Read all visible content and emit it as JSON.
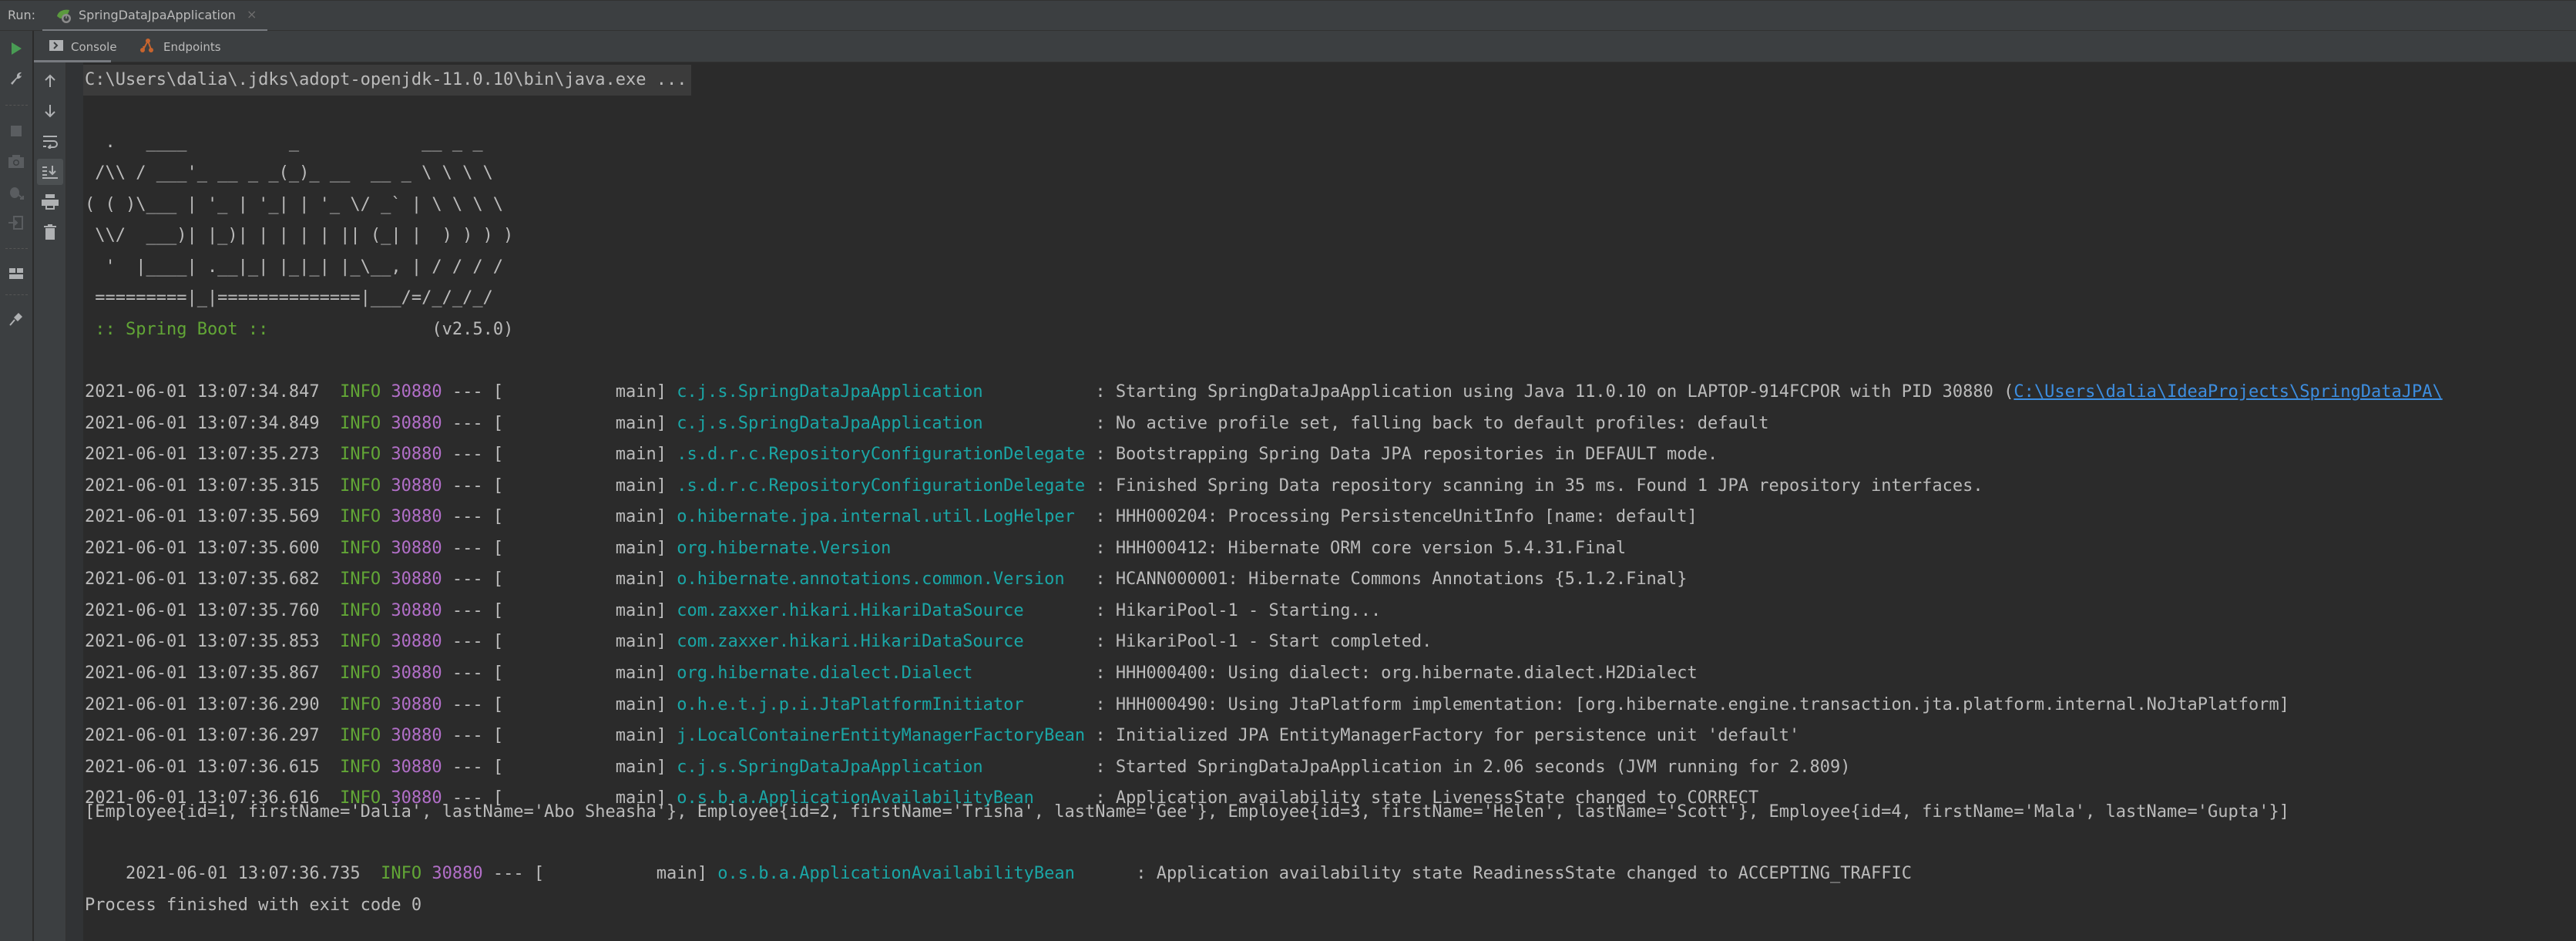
{
  "run_bar": {
    "label": "Run:",
    "tab_title": "SpringDataJpaApplication",
    "tab_icon": "spring-boot-icon",
    "close_glyph": "×"
  },
  "sub_tabs": [
    {
      "label": "Console",
      "icon": "console-icon",
      "active": true
    },
    {
      "label": "Endpoints",
      "icon": "endpoints-icon",
      "active": false
    }
  ],
  "left_toolbar": [
    "run-icon",
    "wrench-icon",
    "stop-icon",
    "camera-icon",
    "debug-icon",
    "login-icon",
    "layout-icon",
    "pin-icon"
  ],
  "console_toolbar": [
    "arrow-up-icon",
    "arrow-down-icon",
    "soft-wrap-icon",
    "scroll-to-end-icon",
    "print-icon",
    "trash-icon"
  ],
  "console": {
    "command": "C:\\Users\\dalia\\.jdks\\adopt-openjdk-11.0.10\\bin\\java.exe ...",
    "banner": [
      "  .   ____          _            __ _ _",
      " /\\\\ / ___'_ __ _ _(_)_ __  __ _ \\ \\ \\ \\",
      "( ( )\\___ | '_ | '_| | '_ \\/ _` | \\ \\ \\ \\",
      " \\\\/  ___)| |_)| | | | | || (_| |  ) ) ) )",
      "  '  |____| .__|_| |_|_| |_\\__, | / / / /",
      " =========|_|==============|___/=/_/_/_/"
    ],
    "spring_boot_label": " :: Spring Boot :: ",
    "spring_boot_version": "               (v2.5.0)",
    "log_lines": [
      {
        "ts": "2021-06-01 13:07:34.847",
        "level": "INFO",
        "pid": "30880",
        "sep": " --- [",
        "thread": "           main] ",
        "logger": "c.j.s.SpringDataJpaApplication          ",
        "msg": " : Starting SpringDataJpaApplication using Java 11.0.10 on LAPTOP-914FCPOR with PID 30880 (",
        "link": "C:\\Users\\dalia\\IdeaProjects\\SpringDataJPA\\"
      },
      {
        "ts": "2021-06-01 13:07:34.849",
        "level": "INFO",
        "pid": "30880",
        "sep": " --- [",
        "thread": "           main] ",
        "logger": "c.j.s.SpringDataJpaApplication          ",
        "msg": " : No active profile set, falling back to default profiles: default"
      },
      {
        "ts": "2021-06-01 13:07:35.273",
        "level": "INFO",
        "pid": "30880",
        "sep": " --- [",
        "thread": "           main] ",
        "logger": ".s.d.r.c.RepositoryConfigurationDelegate",
        "msg": " : Bootstrapping Spring Data JPA repositories in DEFAULT mode."
      },
      {
        "ts": "2021-06-01 13:07:35.315",
        "level": "INFO",
        "pid": "30880",
        "sep": " --- [",
        "thread": "           main] ",
        "logger": ".s.d.r.c.RepositoryConfigurationDelegate",
        "msg": " : Finished Spring Data repository scanning in 35 ms. Found 1 JPA repository interfaces."
      },
      {
        "ts": "2021-06-01 13:07:35.569",
        "level": "INFO",
        "pid": "30880",
        "sep": " --- [",
        "thread": "           main] ",
        "logger": "o.hibernate.jpa.internal.util.LogHelper ",
        "msg": " : HHH000204: Processing PersistenceUnitInfo [name: default]"
      },
      {
        "ts": "2021-06-01 13:07:35.600",
        "level": "INFO",
        "pid": "30880",
        "sep": " --- [",
        "thread": "           main] ",
        "logger": "org.hibernate.Version                   ",
        "msg": " : HHH000412: Hibernate ORM core version 5.4.31.Final"
      },
      {
        "ts": "2021-06-01 13:07:35.682",
        "level": "INFO",
        "pid": "30880",
        "sep": " --- [",
        "thread": "           main] ",
        "logger": "o.hibernate.annotations.common.Version  ",
        "msg": " : HCANN000001: Hibernate Commons Annotations {5.1.2.Final}"
      },
      {
        "ts": "2021-06-01 13:07:35.760",
        "level": "INFO",
        "pid": "30880",
        "sep": " --- [",
        "thread": "           main] ",
        "logger": "com.zaxxer.hikari.HikariDataSource      ",
        "msg": " : HikariPool-1 - Starting..."
      },
      {
        "ts": "2021-06-01 13:07:35.853",
        "level": "INFO",
        "pid": "30880",
        "sep": " --- [",
        "thread": "           main] ",
        "logger": "com.zaxxer.hikari.HikariDataSource      ",
        "msg": " : HikariPool-1 - Start completed."
      },
      {
        "ts": "2021-06-01 13:07:35.867",
        "level": "INFO",
        "pid": "30880",
        "sep": " --- [",
        "thread": "           main] ",
        "logger": "org.hibernate.dialect.Dialect           ",
        "msg": " : HHH000400: Using dialect: org.hibernate.dialect.H2Dialect"
      },
      {
        "ts": "2021-06-01 13:07:36.290",
        "level": "INFO",
        "pid": "30880",
        "sep": " --- [",
        "thread": "           main] ",
        "logger": "o.h.e.t.j.p.i.JtaPlatformInitiator      ",
        "msg": " : HHH000490: Using JtaPlatform implementation: [org.hibernate.engine.transaction.jta.platform.internal.NoJtaPlatform]"
      },
      {
        "ts": "2021-06-01 13:07:36.297",
        "level": "INFO",
        "pid": "30880",
        "sep": " --- [",
        "thread": "           main] ",
        "logger": "j.LocalContainerEntityManagerFactoryBean",
        "msg": " : Initialized JPA EntityManagerFactory for persistence unit 'default'"
      },
      {
        "ts": "2021-06-01 13:07:36.615",
        "level": "INFO",
        "pid": "30880",
        "sep": " --- [",
        "thread": "           main] ",
        "logger": "c.j.s.SpringDataJpaApplication          ",
        "msg": " : Started SpringDataJpaApplication in 2.06 seconds (JVM running for 2.809)"
      },
      {
        "ts": "2021-06-01 13:07:36.616",
        "level": "INFO",
        "pid": "30880",
        "sep": " --- [",
        "thread": "           main] ",
        "logger": "o.s.b.a.ApplicationAvailabilityBean     ",
        "msg": " : Application availability state LivenessState changed to CORRECT"
      }
    ],
    "output_line": "[Employee{id=1, firstName='Dalia', lastName='Abo Sheasha'}, Employee{id=2, firstName='Trisha', lastName='Gee'}, Employee{id=3, firstName='Helen', lastName='Scott'}, Employee{id=4, firstName='Mala', lastName='Gupta'}]",
    "last_log": {
      "ts": "2021-06-01 13:07:36.735",
      "level": "INFO",
      "pid": "30880",
      "sep": " --- [",
      "thread": "           main] ",
      "logger": "o.s.b.a.ApplicationAvailabilityBean     ",
      "msg": " : Application availability state ReadinessState changed to ACCEPTING_TRAFFIC"
    },
    "exit_message": "Process finished with exit code 0"
  },
  "colors": {
    "level": "#62a636",
    "pid": "#b26fc8",
    "logger": "#1aa6a6",
    "link": "#3d8ee0",
    "spring_boot_label": "#62a636"
  }
}
